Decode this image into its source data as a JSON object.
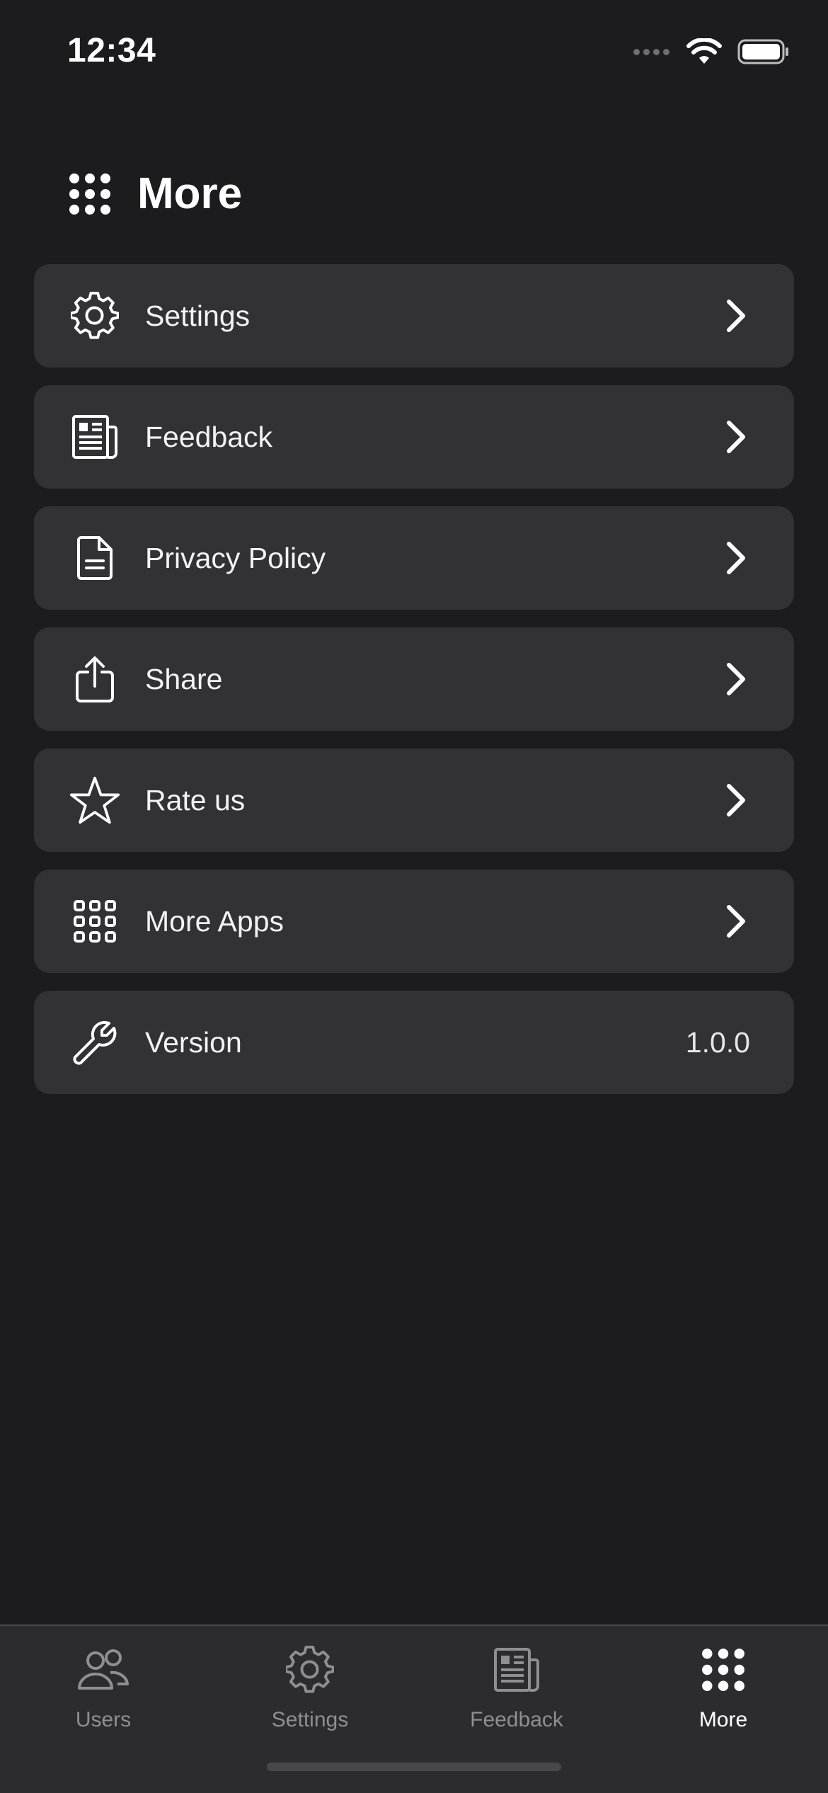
{
  "status_bar": {
    "time": "12:34"
  },
  "header": {
    "title": "More",
    "icon": "grid-dots-icon"
  },
  "menu": [
    {
      "label": "Settings",
      "icon": "gear-icon",
      "accessory": "chevron"
    },
    {
      "label": "Feedback",
      "icon": "newspaper-icon",
      "accessory": "chevron"
    },
    {
      "label": "Privacy Policy",
      "icon": "document-icon",
      "accessory": "chevron"
    },
    {
      "label": "Share",
      "icon": "share-icon",
      "accessory": "chevron"
    },
    {
      "label": "Rate us",
      "icon": "star-icon",
      "accessory": "chevron"
    },
    {
      "label": "More Apps",
      "icon": "apps-grid-icon",
      "accessory": "chevron"
    },
    {
      "label": "Version",
      "icon": "wrench-icon",
      "value": "1.0.0"
    }
  ],
  "tab_bar": {
    "items": [
      {
        "label": "Users",
        "icon": "users-icon",
        "active": false
      },
      {
        "label": "Settings",
        "icon": "gear-icon",
        "active": false
      },
      {
        "label": "Feedback",
        "icon": "newspaper-icon",
        "active": false
      },
      {
        "label": "More",
        "icon": "grid-dots-icon",
        "active": true
      }
    ]
  },
  "colors": {
    "background": "#1c1c1e",
    "row_background": "#323234",
    "tab_bar_background": "#2c2c2e",
    "inactive_tab": "#8e8e93",
    "active_tab": "#ffffff"
  }
}
